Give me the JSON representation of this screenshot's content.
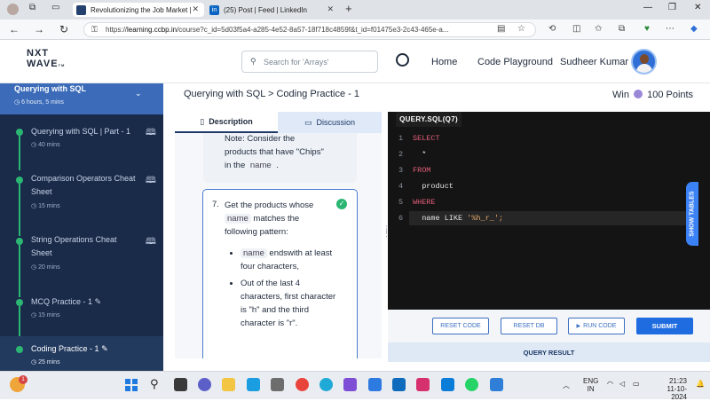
{
  "browser": {
    "tabs": [
      {
        "title": "Revolutionizing the Job Market |",
        "active": true
      },
      {
        "title": "(25) Post | Feed | LinkedIn",
        "active": false
      }
    ],
    "url_prefix": "https://",
    "url_host": "learning.ccbp.in",
    "url_rest": "/course?c_id=5d03f5a4-a285-4e52-8a57-18f718c4859f&t_id=f01475e3-2c43-465e-a..."
  },
  "header": {
    "logo_line1": "NXT",
    "logo_line2": "WAVE",
    "logo_tm": "TM",
    "search_placeholder": "Search for 'Arrays'",
    "nav": [
      "Home",
      "Code Playground"
    ],
    "user_name": "Sudheer Kumar"
  },
  "sidebar": {
    "course_title": "Querying with SQL",
    "course_duration": "6 hours, 5 mins",
    "items": [
      {
        "title": "Querying with SQL | Part - 1",
        "duration": "40 mins",
        "icon": "book-icon"
      },
      {
        "title": "Comparison Operators Cheat Sheet",
        "duration": "15 mins",
        "icon": "book-icon"
      },
      {
        "title": "String Operations Cheat Sheet",
        "duration": "20 mins",
        "icon": "book-icon"
      },
      {
        "title": "MCQ Practice - 1",
        "duration": "15 mins",
        "icon": "pencil-icon"
      },
      {
        "title": "Coding Practice - 1",
        "duration": "25 mins",
        "icon": "pencil-icon"
      }
    ]
  },
  "main": {
    "breadcrumb": "Querying with SQL > Coding Practice - 1",
    "win_label": "Win",
    "points_label": "100 Points",
    "tabs": {
      "description": "Description",
      "discussion": "Discussion"
    },
    "note": {
      "text_before": "Note: Consider the products that have \"Chips\" in the",
      "code": "name",
      "text_after": "."
    },
    "question": {
      "number": "7.",
      "text_before": "Get the products whose",
      "code": "name",
      "text_after": "matches the following pattern:",
      "bullets": [
        {
          "code": "name",
          "text": "endswith at least four characters,"
        },
        {
          "code": "",
          "text": "Out of the last 4 characters, first character is \"h\" and the third character is \"r\"."
        }
      ]
    }
  },
  "editor": {
    "tab_label": "QUERY.SQL(Q7)",
    "lines": [
      {
        "n": "1",
        "kw": "SELECT",
        "text": "",
        "str": ""
      },
      {
        "n": "2",
        "kw": "",
        "text": "  *",
        "str": ""
      },
      {
        "n": "3",
        "kw": "FROM",
        "text": "",
        "str": ""
      },
      {
        "n": "4",
        "kw": "",
        "text": "  product",
        "str": ""
      },
      {
        "n": "5",
        "kw": "WHERE",
        "text": "",
        "str": ""
      },
      {
        "n": "6",
        "kw": "",
        "text": "  name LIKE ",
        "str": "'%h_r_';"
      }
    ],
    "buttons": {
      "reset_code": "RESET CODE",
      "reset_db": "RESET DB",
      "run_code": "RUN CODE",
      "submit": "SUBMIT"
    },
    "query_result": "QUERY RESULT",
    "show_tables": "SHOW TABLES"
  },
  "taskbar": {
    "lang_line1": "ENG",
    "lang_line2": "IN",
    "time": "21:23",
    "date": "11-10-2024",
    "badge": "1"
  }
}
